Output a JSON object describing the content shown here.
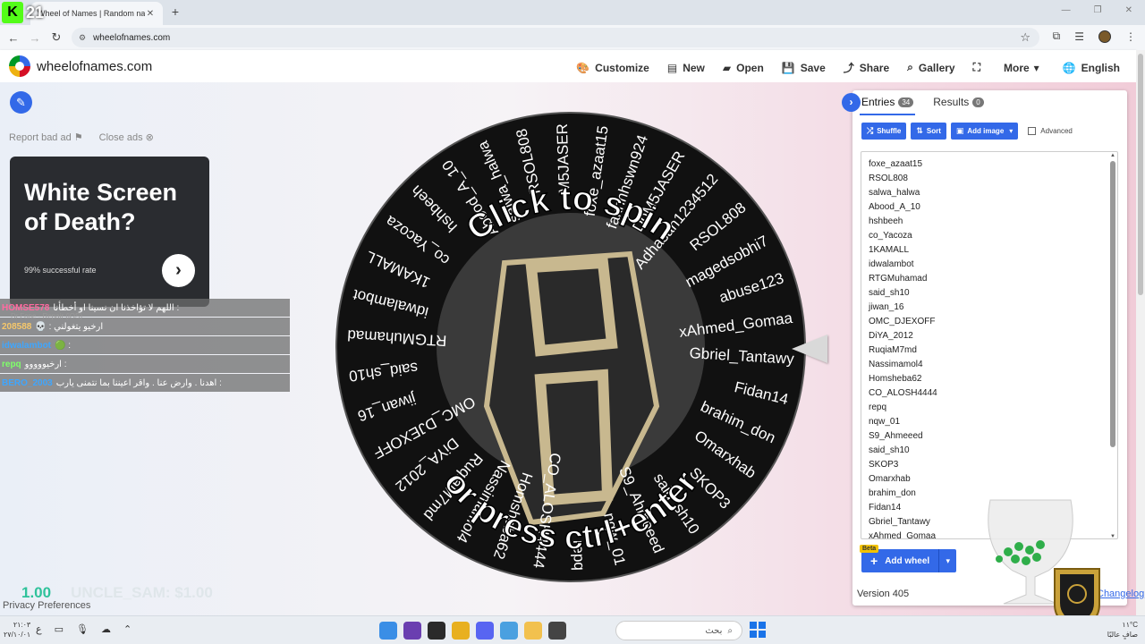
{
  "browser": {
    "stream_badge": "21",
    "tab_title": "Wheel of Names | Random nam",
    "url": "wheelofnames.com"
  },
  "header": {
    "brand": "wheelofnames.com",
    "menu": [
      {
        "label": "Customize",
        "icon": "palette-icon"
      },
      {
        "label": "New",
        "icon": "file-icon"
      },
      {
        "label": "Open",
        "icon": "folder-icon"
      },
      {
        "label": "Save",
        "icon": "save-icon"
      },
      {
        "label": "Share",
        "icon": "share-icon"
      },
      {
        "label": "Gallery",
        "icon": "search-icon"
      },
      {
        "label": "",
        "icon": "fullscreen-icon"
      },
      {
        "label": "More",
        "icon": "chevron-down-icon"
      },
      {
        "label": "English",
        "icon": "globe-icon"
      }
    ]
  },
  "ads": {
    "report": "Report bad ad",
    "close": "Close ads",
    "title": "White Screen of Death?",
    "subtitle": "99% successful rate"
  },
  "chat": [
    {
      "user": "HOMSE578",
      "text": "اللهم لا تؤاخذنا ان نسينا او أخطأنا :",
      "color": "#ff6aa0"
    },
    {
      "user": "208588",
      "text": "💀 : ارخيو يتغولني",
      "color": "#f5c76b"
    },
    {
      "user": "idwalambot",
      "text": "🟢 :",
      "color": "#3ea6ff"
    },
    {
      "user": "repq",
      "text": "ارخيووووو :",
      "color": "#7fff6a"
    },
    {
      "user": "BERO_2003",
      "text": "اهدنا . وارض عنا . واقر اعيننا بما نتمنى يارب :",
      "color": "#3ea6ff"
    }
  ],
  "chat_ghost": "Dr.Fone - Repair (iOS)",
  "donation": {
    "amount": "1.00",
    "ghost": "UNCLE_SAM: $1.00"
  },
  "privacy": "Privacy Preferences",
  "wheel": {
    "cta_top": "Click to spin",
    "cta_bottom": "or press ctrl+enter",
    "colors": {
      "bg": "#111111",
      "center": "#3a3a3a",
      "accent": "#c8b88f"
    }
  },
  "panel": {
    "tabs": [
      {
        "label": "Entries",
        "count": "34"
      },
      {
        "label": "Results",
        "count": "0"
      }
    ],
    "toolbar": {
      "shuffle": "Shuffle",
      "sort": "Sort",
      "add_image": "Add image",
      "advanced": "Advanced"
    },
    "entries": [
      "foxe_azaat15",
      "RSOL808",
      "salwa_halwa",
      "Abood_A_10",
      "hshbeeh",
      "co_Yacoza",
      "1KAMALL",
      "idwalambot",
      "RTGMuhamad",
      "said_sh10",
      "jiwan_16",
      "OMC_DJEXOFF",
      "DiYA_2012",
      "RuqiaM7md",
      "Nassimamol4",
      "Homsheba62",
      "CO_ALOSH4444",
      "repq",
      "nqw_01",
      "S9_Ahmeeed",
      "said_sh10",
      "SKOP3",
      "Omarxhab",
      "brahim_don",
      "Fidan14",
      "Gbriel_Tantawy",
      "xAhmed_Gomaa"
    ],
    "wheel_labels": [
      "foxe_azaat15",
      "fakhnhswn924",
      "DoM5JASER",
      "Adhasan1234512",
      "RSOL808",
      "magedsobhi7",
      "abuse123",
      "xAhmed_Gomaa",
      "Gbriel_Tantawy",
      "Fidan14",
      "brahim_don",
      "Omarxhab",
      "SKOP3",
      "said_sh10",
      "S9_Ahmeeed",
      "nqw_01",
      "repq",
      "CO_ALOSH4444",
      "Homsheba62",
      "Nassimamol4",
      "RuqiaM7md",
      "DiYA_2012",
      "OMC_DJEXOFF",
      "jiwan_16",
      "said_sh10",
      "RTGMuhamad",
      "idwalambot",
      "1KAMALL",
      "co_Yacoza",
      "hshbeeh",
      "Abood_A_10",
      "salwa_halwa",
      "RSOL808",
      "M5JASER"
    ],
    "beta": "Beta",
    "add_wheel": "Add wheel",
    "version": "Version 405",
    "changelog": "Changelog"
  },
  "taskbar": {
    "date": "٢٧/١٠/٠١",
    "time": "٢١:٠٣",
    "search": "بحث",
    "weather_temp": "١١°C",
    "weather_desc": "صافٍ عالبًا"
  }
}
